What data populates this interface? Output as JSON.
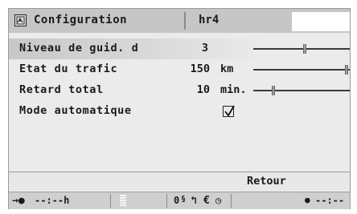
{
  "header": {
    "title": "Configuration",
    "icon": "navigation-settings-icon",
    "station": "hr4"
  },
  "rows": [
    {
      "label": "Niveau de guid. d",
      "value": "3",
      "unit": "",
      "slider_level": 0.54,
      "selected": true
    },
    {
      "label": "Etat du trafic",
      "value": "150",
      "unit": "km",
      "slider_level": 1.0,
      "selected": false
    },
    {
      "label": "Retard total",
      "value": "10",
      "unit": "min.",
      "slider_level": 0.2,
      "selected": false
    },
    {
      "label": "Mode automatique",
      "checked": true
    }
  ],
  "footer": {
    "retour_label": "Retour"
  },
  "status": {
    "arrival_time": "--:--h",
    "zero_label": "0",
    "current_time": "--:--",
    "icons": [
      "arrow-right-icon",
      "signal-bars-icon",
      "tmc-icon",
      "turn-arrow-icon",
      "euro-icon",
      "clock-icon",
      "dot-icon"
    ]
  },
  "colors": {
    "background": "#ebebeb",
    "header": "#c6c6c6",
    "text": "#1a1a1a",
    "status_bar": "#cfcfcf"
  }
}
